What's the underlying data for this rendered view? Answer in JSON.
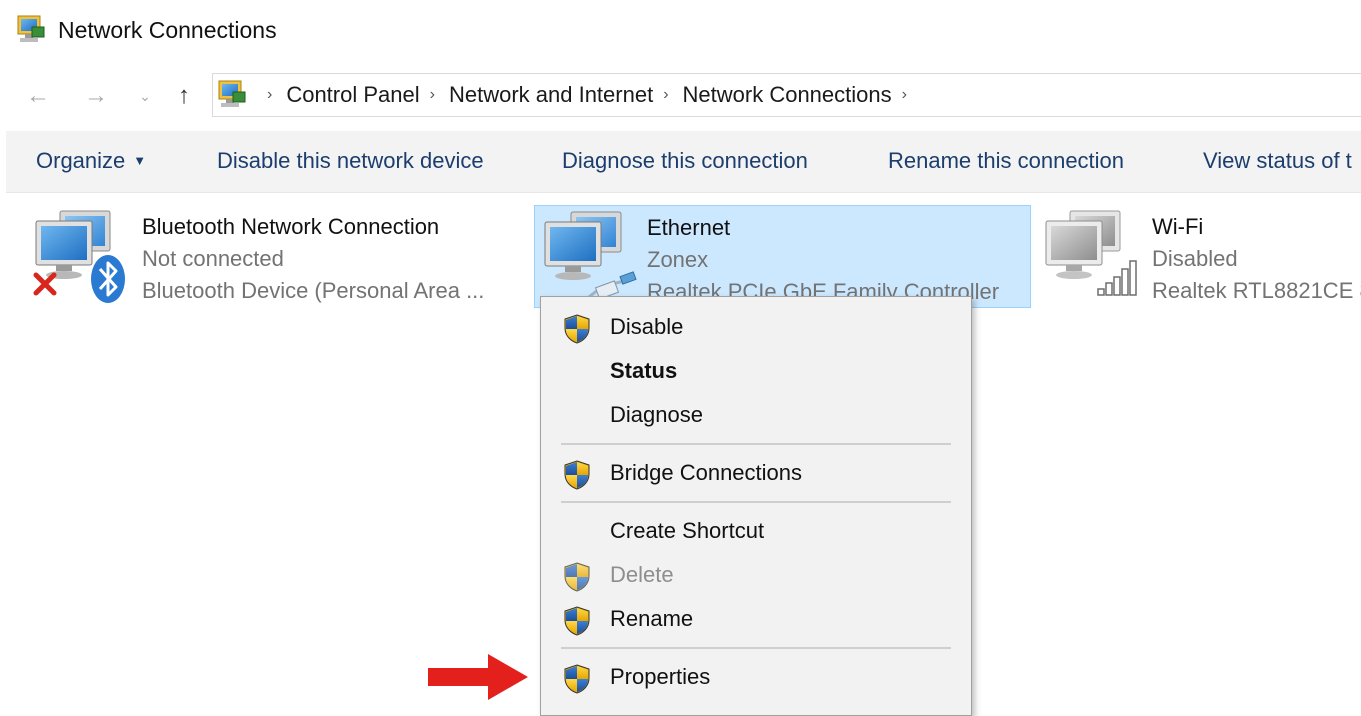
{
  "window": {
    "title": "Network Connections"
  },
  "navigation": {
    "back_icon": "arrow-left-icon",
    "forward_icon": "arrow-right-icon",
    "recent_icon": "chevron-down-icon",
    "up_icon": "arrow-up-icon",
    "breadcrumbs": [
      "Control Panel",
      "Network and Internet",
      "Network Connections"
    ]
  },
  "toolbar": {
    "organize_label": "Organize",
    "disable_label": "Disable this network device",
    "diagnose_label": "Diagnose this connection",
    "rename_label": "Rename this connection",
    "view_status_label": "View status of t"
  },
  "connections": [
    {
      "name": "Bluetooth Network Connection",
      "status": "Not connected",
      "device": "Bluetooth Device (Personal Area ...",
      "icon": "bluetooth-network-icon"
    },
    {
      "name": "Ethernet",
      "status": "Zonex",
      "device": "Realtek PCIe GbE Family Controller",
      "icon": "ethernet-network-icon",
      "selected": true
    },
    {
      "name": "Wi-Fi",
      "status": "Disabled",
      "device": "Realtek RTL8821CE 8",
      "icon": "wifi-network-icon"
    }
  ],
  "context_menu": {
    "items": [
      {
        "label": "Disable",
        "shield": true
      },
      {
        "label": "Status",
        "bold": true
      },
      {
        "label": "Diagnose"
      },
      {
        "label": "Bridge Connections",
        "shield": true
      },
      {
        "label": "Create Shortcut"
      },
      {
        "label": "Delete",
        "shield": true,
        "disabled": true
      },
      {
        "label": "Rename",
        "shield": true
      },
      {
        "label": "Properties",
        "shield": true
      }
    ]
  },
  "colors": {
    "selection_bg": "#cce8ff",
    "selection_border": "#99d1ff",
    "command_text": "#1c3e6e",
    "annotation_arrow": "#e3201b"
  }
}
